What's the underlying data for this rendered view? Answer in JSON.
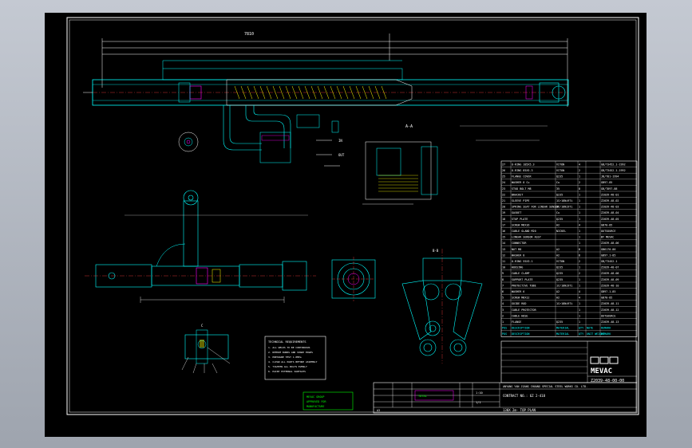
{
  "title_block": {
    "project_line1": "ANYANG YAN JIANG CHUANG SPECIAL STEEL WORKS CO. LTD.",
    "project_line2": "CONTRACT NO.: 6Z 2-418",
    "drawing_title": "130X 2m- TOP PLAN",
    "drawing_number": "Z2039-48-00-00",
    "company": "MEVAC",
    "sheet": "1/1",
    "scale": "1:10",
    "mid_label": "TOTAL",
    "rev_label": "A3"
  },
  "parts_list": {
    "header": [
      "POS",
      "DESCRIPTION",
      "MATERIAL",
      "QTY",
      "NOTE",
      "REMARK"
    ],
    "rows": [
      [
        "27",
        "O-RING 185X5.3",
        "VITON",
        "4",
        "",
        "GB/T3452.1-1992"
      ],
      [
        "26",
        "O-RING 85X5.3",
        "VITON",
        "2",
        "",
        "GB/T3452.1-1992"
      ],
      [
        "25",
        "FLANGE COVER",
        "Q235",
        "1",
        "",
        "JB/T81-1994"
      ],
      [
        "24",
        "WASHER 8 Cu",
        "Cu",
        "2",
        "",
        "GB97-85"
      ],
      [
        "23",
        "STUD BOLT M8",
        "35",
        "8",
        "",
        "GB/T897-88"
      ],
      [
        "22",
        "BRACKET",
        "Q235",
        "1",
        "",
        "Z2039-48-01"
      ],
      [
        "21",
        "SLEEVE PIPE",
        "1Cr18Ni9Ti",
        "1",
        "",
        "Z2039-48-02"
      ],
      [
        "20",
        "SPRING SEAT FOR LINEAR SENSOR",
        "1Cr18Ni9Ti",
        "1",
        "",
        "Z2039-48-03"
      ],
      [
        "19",
        "GASKET",
        "Cu",
        "1",
        "",
        "Z2039-48-04"
      ],
      [
        "18",
        "STOP PLATE",
        "Q235",
        "1",
        "",
        "Z2039-48-05"
      ],
      [
        "17",
        "SCREW M6X16",
        "A2",
        "4",
        "",
        "GB70-85"
      ],
      [
        "16",
        "CABLE GLAND M20",
        "NICKEL",
        "1",
        "",
        "OUTSOURCE"
      ],
      [
        "15",
        "LINEAR SENSOR ASSY",
        "",
        "1",
        "",
        "BY MEVAC"
      ],
      [
        "14",
        "CONNECTOR",
        "",
        "1",
        "",
        "Z2039-48-06"
      ],
      [
        "13",
        "NUT M8",
        "A2",
        "8",
        "",
        "GB6170-86"
      ],
      [
        "12",
        "WASHER 8",
        "A2",
        "8",
        "",
        "GB97.1-85"
      ],
      [
        "11",
        "O-RING 55X3.1",
        "VITON",
        "2",
        "",
        "GB/T3452.1"
      ],
      [
        "10",
        "HOUSING",
        "Q235",
        "1",
        "",
        "Z2039-48-07"
      ],
      [
        "9",
        "CABLE CLAMP",
        "Q235",
        "2",
        "",
        "Z2039-48-08"
      ],
      [
        "8",
        "SUPPORT PLATE",
        "Q235",
        "1",
        "",
        "Z2039-48-09"
      ],
      [
        "7",
        "PROTECTIVE TUBE",
        "1Cr18Ni9Ti",
        "1",
        "",
        "Z2039-48-10"
      ],
      [
        "6",
        "WASHER 6",
        "A2",
        "4",
        "",
        "GB97.1-85"
      ],
      [
        "5",
        "SCREW M6X12",
        "A2",
        "4",
        "",
        "GB70-85"
      ],
      [
        "4",
        "GUIDE ROD",
        "1Cr18Ni9Ti",
        "1",
        "",
        "Z2039-48-11"
      ],
      [
        "3",
        "CABLE PROTECTOR",
        "",
        "1",
        "",
        "Z2039-48-12"
      ],
      [
        "2",
        "CABLE HOSE",
        "",
        "1",
        "",
        "OUTSOURCE"
      ],
      [
        "1",
        "FLANGE",
        "Q235",
        "1",
        "",
        "Z2039-48-13"
      ]
    ],
    "footer": [
      "POS",
      "DESCRIPTION",
      "MATERIAL",
      "QTY",
      "UNIT WEIGHT",
      "REMARK"
    ]
  },
  "notes": {
    "title": "TECHNICAL REQUIREMENTS",
    "lines": [
      "1. ALL WELDS TO BE CONTINUOUS",
      "2. REMOVE BURRS AND SHARP EDGES",
      "3. PRESSURE TEST 1.0MPa",
      "4. CLEAN ALL PARTS BEFORE ASSEMBLY",
      "5. TIGHTEN ALL BOLTS EVENLY",
      "6. PAINT EXTERNAL SURFACES"
    ]
  },
  "stamp": {
    "lines": [
      "MEVAC GROUP",
      "APPROVED FOR",
      "MANUFACTURE"
    ]
  },
  "labels": {
    "section_a": "A-A",
    "section_b": "B-B",
    "view_c": "C",
    "dim_top": "7810",
    "water_in": "IN",
    "water_out": "OUT"
  },
  "colors": {
    "background": "#000000",
    "frame": "#ffffff",
    "outline": "#00ffff",
    "centerline": "#ff4040",
    "text": "#00ff00",
    "hatch": "#ffff00",
    "highlight": "#ff00ff"
  }
}
